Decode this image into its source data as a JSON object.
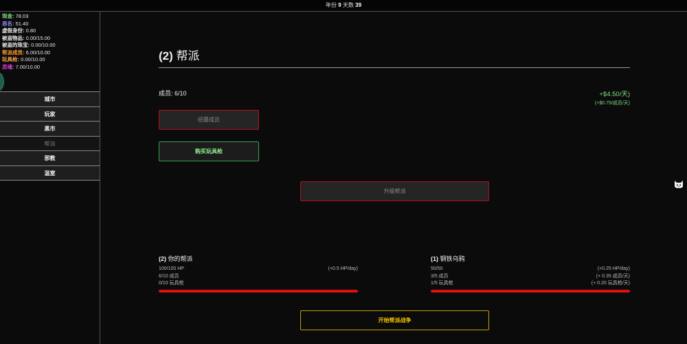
{
  "topbar": {
    "year_label": "年份",
    "year": "9",
    "day_label": "天数",
    "day": "39"
  },
  "stats": [
    {
      "key": "现金:",
      "value": "78.03",
      "color": "#7fe07f"
    },
    {
      "key": "恶名:",
      "value": "51.40",
      "color": "#8c8cff"
    },
    {
      "key": "虚假身份:",
      "value": "0.80",
      "color": "#e8e8e8"
    },
    {
      "key": "被盗物品:",
      "value": "0.00/15.00",
      "color": "#e8e8e8"
    },
    {
      "key": "被盗的珠宝:",
      "value": "0.00/10.00",
      "color": "#e8e8e8"
    },
    {
      "key": "帮派成员:",
      "value": "6.00/10.00",
      "color": "#ff9a2e"
    },
    {
      "key": "玩具枪:",
      "value": "0.00/10.00",
      "color": "#ffa64d"
    },
    {
      "key": "灵魂:",
      "value": "7.00/10.00",
      "color": "#e040e0"
    }
  ],
  "nav": {
    "items": [
      {
        "label": "城市",
        "active": false
      },
      {
        "label": "玩家",
        "active": false
      },
      {
        "label": "黑市",
        "active": false
      },
      {
        "label": "帮派",
        "active": true
      },
      {
        "label": "邪教",
        "active": false
      },
      {
        "label": "温室",
        "active": false
      }
    ]
  },
  "page": {
    "title_num": "(2)",
    "title": "帮派",
    "members": "成员: 6/10",
    "income_main": "+$4.50/天)",
    "income_sub": "(+$0.75/成员/天)"
  },
  "buttons": {
    "recruit": "招募成员",
    "buy_gun": "购买玩具枪",
    "upgrade": "升级帮派",
    "war": "开始帮派战争"
  },
  "gangs": {
    "mine": {
      "num": "(2)",
      "name": "你的帮派",
      "hp": "100/100 HP",
      "hp_regen": "(+0.5 HP/day)",
      "members": "6/10 成员",
      "members_rate": "",
      "guns": "0/10 玩具枪",
      "guns_rate": "",
      "hp_fraction": 1.0
    },
    "enemy": {
      "num": "(1)",
      "name": "钢铁乌鸦",
      "hp": "50/50",
      "hp_regen": "(+0.25 HP/day)",
      "members": "3/5 成员",
      "members_rate": "(+ 0.35 成员/天)",
      "guns": "1/5 玩具枪",
      "guns_rate": "(+ 0.20 玩具枪/天)",
      "hp_fraction": 1.0
    }
  },
  "colors": {
    "background": "#0b0b0b",
    "danger": "#b01020",
    "success": "#3ca050",
    "warning": "#c8a000",
    "hp": "#e01010"
  },
  "icons": {
    "side_widget": "cat-face-icon"
  }
}
